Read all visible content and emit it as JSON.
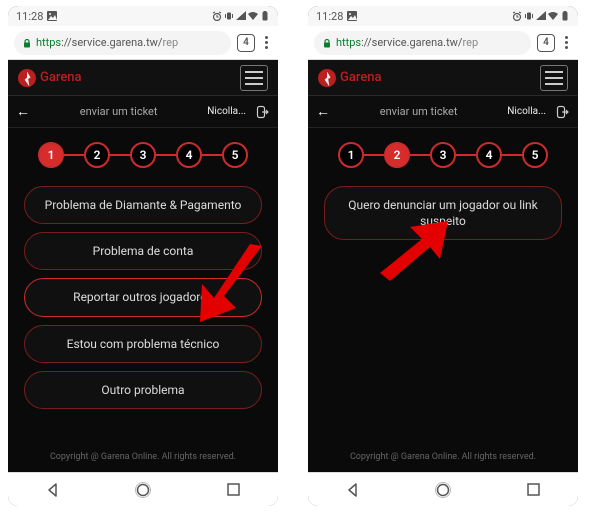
{
  "status": {
    "time": "11:28",
    "status_icon_left": "image-icon"
  },
  "browser": {
    "url_scheme": "https",
    "url_host": "://service.garena.tw/",
    "url_path": "rep",
    "tab_count": "4"
  },
  "brand": {
    "name": "Garena"
  },
  "subheader": {
    "title": "enviar um ticket",
    "user": "Nicolla..."
  },
  "steps": [
    "1",
    "2",
    "3",
    "4",
    "5"
  ],
  "left": {
    "active_step": 1,
    "options": [
      "Problema de Diamante & Pagamento",
      "Problema de conta",
      "Reportar outros jogadores",
      "Estou com problema técnico",
      "Outro problema"
    ]
  },
  "right": {
    "active_step": 2,
    "options": [
      "Quero denunciar um jogador ou link suspeito"
    ]
  },
  "footer": {
    "copyright": "Copyright @ Garena Online. All rights reserved."
  }
}
